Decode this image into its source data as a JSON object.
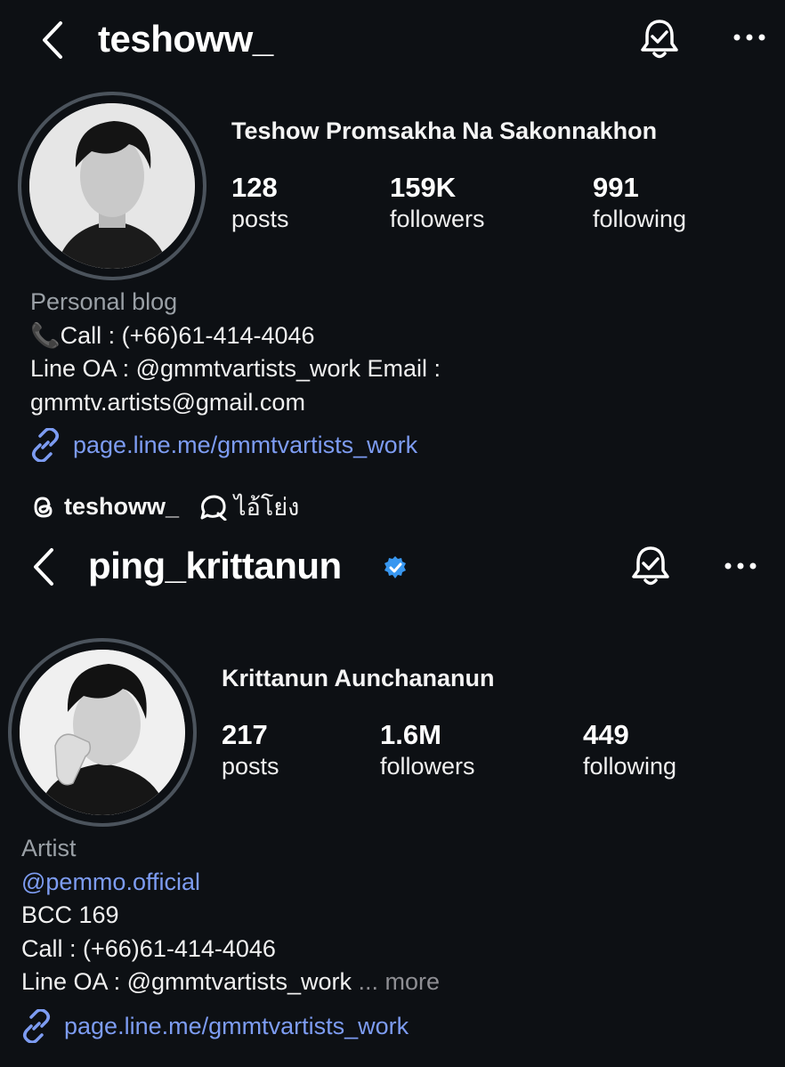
{
  "profiles": [
    {
      "username": "teshoww_",
      "verified": false,
      "full_name": "Teshow Promsakha Na Sakonnakhon",
      "stats": [
        {
          "value": "128",
          "label": "posts"
        },
        {
          "value": "159K",
          "label": "followers"
        },
        {
          "value": "991",
          "label": "following"
        }
      ],
      "category": "Personal blog",
      "bio_lines": [
        "📞Call : (+66)61-414-4046",
        "Line OA : @gmmtvartists_work Email :",
        "gmmtv.artists@gmail.com"
      ],
      "link": "page.line.me/gmmtvartists_work",
      "threads_handle": "teshoww_",
      "threads_note": "ไอ้โย่ง"
    },
    {
      "username": "ping_krittanun",
      "verified": true,
      "full_name": "Krittanun Aunchananun",
      "stats": [
        {
          "value": "217",
          "label": "posts"
        },
        {
          "value": "1.6M",
          "label": "followers"
        },
        {
          "value": "449",
          "label": "following"
        }
      ],
      "category": "Artist",
      "mention": "@pemmo.official",
      "bio_lines": [
        "BCC 169",
        "Call : (+66)61-414-4046",
        "Line OA : @gmmtvartists_work"
      ],
      "more_label": "... more",
      "link": "page.line.me/gmmtvartists_work"
    }
  ],
  "icons": {
    "back": "chevron-left-icon",
    "bell": "bell-check-icon",
    "more": "more-horizontal-icon",
    "verified": "verified-badge-icon",
    "link": "link-icon",
    "threads": "threads-icon",
    "chat": "chat-bubble-icon"
  },
  "colors": {
    "background": "#0d1014",
    "link": "#7d9cf2",
    "verified": "#3897f0",
    "muted": "#9aa0a6"
  }
}
